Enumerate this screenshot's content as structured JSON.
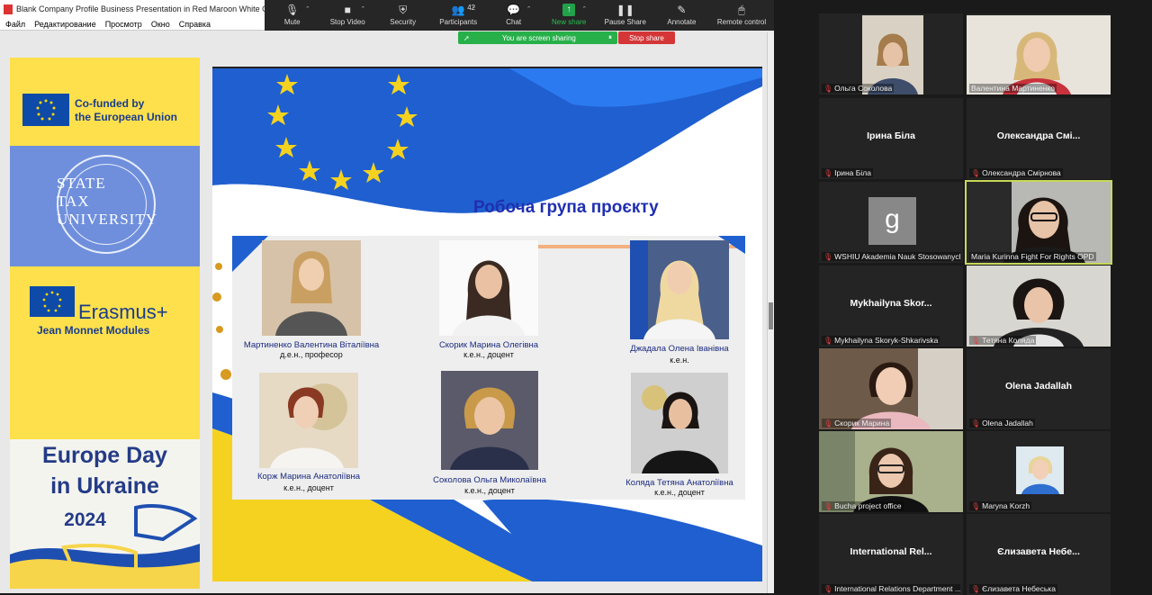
{
  "window": {
    "title": "Blank Company Profile Business Presentation in Red Maroon White Geometric"
  },
  "menu": [
    "Файл",
    "Редактирование",
    "Просмотр",
    "Окно",
    "Справка"
  ],
  "toolbar": {
    "mute": "Mute",
    "stop_video": "Stop Video",
    "security": "Security",
    "participants": "Participants",
    "participants_count": "42",
    "chat": "Chat",
    "new_share": "New share",
    "pause_share": "Pause Share",
    "annotate": "Annotate",
    "remote_control": "Remote control"
  },
  "sharebar": {
    "text": "You are screen sharing",
    "stop": "Stop share"
  },
  "banner": {
    "cofund_line1": "Co-funded by",
    "cofund_line2": "the European Union",
    "stu_1": "STATE",
    "stu_2": "TAX",
    "stu_3": "UNIVERSITY",
    "erasmus": "Erasmus+",
    "jean_monnet": "Jean Monnet Modules",
    "europe_day_1": "Europe Day",
    "europe_day_2": "in Ukraine",
    "europe_day_3": "2024"
  },
  "slide": {
    "title": "Робоча група проєкту",
    "people": [
      {
        "name": "Мартиненко Валентина Віталіївна",
        "rank": "д.е.н., професор"
      },
      {
        "name": "Скорик Марина Олегівна",
        "rank": "к.е.н., доцент"
      },
      {
        "name": "Джадала Олена Іванівна",
        "rank": "к.е.н."
      },
      {
        "name": "Корж Марина Анатоліївна",
        "rank": "к.е.н., доцент"
      },
      {
        "name": "Соколова Ольга Миколаївна",
        "rank": "к.е.н., доцент"
      },
      {
        "name": "Колядa Тетяна Анатоліївна",
        "rank": "к.е.н., доцент"
      }
    ]
  },
  "gallery": [
    {
      "label": "Ольга Соколова",
      "big": ""
    },
    {
      "label": "Валентина Мартиненко",
      "big": ""
    },
    {
      "label": "Ірина Біла",
      "big": "Ірина Біла"
    },
    {
      "label": "Олександра Смірнова",
      "big": "Олександра Смі..."
    },
    {
      "label": "WSHIU Akademia Nauk Stosowanych",
      "big": "g"
    },
    {
      "label": "Maria Kurinna Fight For Rights OPD",
      "big": ""
    },
    {
      "label": "Mykhailyna Skoryk-Shkarivska",
      "big": "Mykhailyna Skor..."
    },
    {
      "label": "Тетяна Коляда",
      "big": ""
    },
    {
      "label": "Скорик Марина",
      "big": ""
    },
    {
      "label": "Olena Jadallah",
      "big": "Olena Jadallah"
    },
    {
      "label": "Bucha project office",
      "big": ""
    },
    {
      "label": "Maryna Korzh",
      "big": ""
    },
    {
      "label": "International Relations Department ...",
      "big": "International Rel..."
    },
    {
      "label": "Єлизавета Небеська",
      "big": "Єлизавета Небе..."
    }
  ]
}
